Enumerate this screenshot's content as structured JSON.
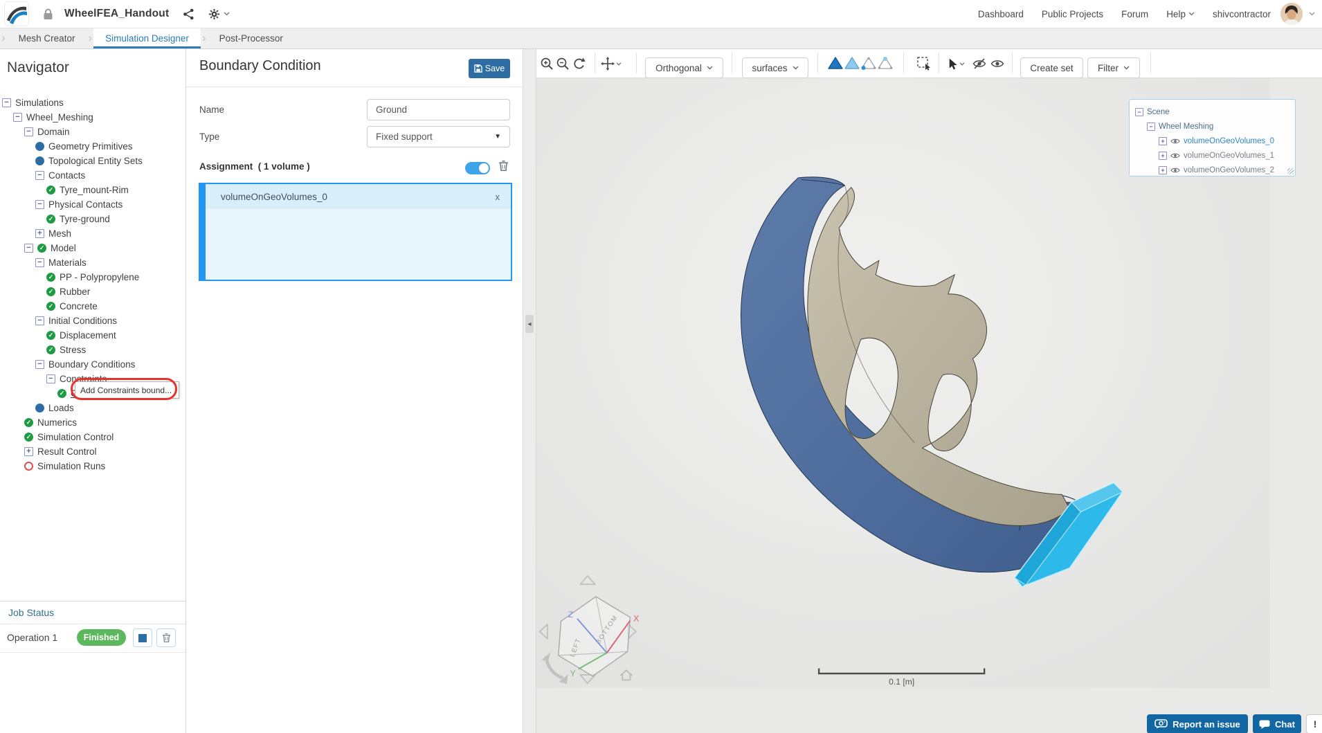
{
  "topbar": {
    "project_title": "WheelFEA_Handout",
    "nav_links": [
      "Dashboard",
      "Public Projects",
      "Forum"
    ],
    "help_label": "Help",
    "username": "shivcontractor"
  },
  "tabs": [
    {
      "label": "Mesh Creator",
      "active": false
    },
    {
      "label": "Simulation Designer",
      "active": true
    },
    {
      "label": "Post-Processor",
      "active": false
    }
  ],
  "navigator": {
    "title": "Navigator",
    "tree": [
      {
        "label": "Simulations",
        "level": 0,
        "expander": "minus"
      },
      {
        "label": "Wheel_Meshing",
        "level": 1,
        "expander": "minus"
      },
      {
        "label": "Domain",
        "level": 2,
        "expander": "minus"
      },
      {
        "label": "Geometry Primitives",
        "level": 3,
        "icon": "blue-dot"
      },
      {
        "label": "Topological Entity Sets",
        "level": 3,
        "icon": "blue-dot"
      },
      {
        "label": "Contacts",
        "level": 3,
        "expander": "minus"
      },
      {
        "label": "Tyre_mount-Rim",
        "level": 4,
        "icon": "check"
      },
      {
        "label": "Physical Contacts",
        "level": 3,
        "expander": "minus"
      },
      {
        "label": "Tyre-ground",
        "level": 4,
        "icon": "check"
      },
      {
        "label": "Mesh",
        "level": 3,
        "expander": "plus"
      },
      {
        "label": "Model",
        "level": 2,
        "expander": "minus",
        "icon": "check"
      },
      {
        "label": "Materials",
        "level": 3,
        "expander": "minus"
      },
      {
        "label": "PP - Polypropylene",
        "level": 4,
        "icon": "check"
      },
      {
        "label": "Rubber",
        "level": 4,
        "icon": "check"
      },
      {
        "label": "Concrete",
        "level": 4,
        "icon": "check"
      },
      {
        "label": "Initial Conditions",
        "level": 3,
        "expander": "minus"
      },
      {
        "label": "Displacement",
        "level": 4,
        "icon": "check"
      },
      {
        "label": "Stress",
        "level": 4,
        "icon": "check"
      },
      {
        "label": "Boundary Conditions",
        "level": 3,
        "expander": "minus"
      },
      {
        "label": "Constraints",
        "level": 4,
        "expander": "minus"
      },
      {
        "label": "Ground",
        "level": 5,
        "icon": "check",
        "underline": true
      },
      {
        "label": "Loads",
        "level": 3,
        "icon": "blue-dot"
      },
      {
        "label": "Numerics",
        "level": 2,
        "icon": "check"
      },
      {
        "label": "Simulation Control",
        "level": 2,
        "icon": "check"
      },
      {
        "label": "Result Control",
        "level": 2,
        "expander": "plus"
      },
      {
        "label": "Simulation Runs",
        "level": 2,
        "icon": "red-circle"
      }
    ],
    "context_tooltip": "Add Constraints bound...",
    "job_status": {
      "header": "Job Status",
      "operation": "Operation 1",
      "badge": "Finished"
    }
  },
  "properties": {
    "title": "Boundary Condition",
    "save_label": "Save",
    "name_label": "Name",
    "name_value": "Ground",
    "type_label": "Type",
    "type_value": "Fixed support",
    "assignment_label": "Assignment",
    "assignment_count": "( 1 volume )",
    "assignment_item": "volumeOnGeoVolumes_0",
    "remove_label": "x"
  },
  "viewport": {
    "toolbar": {
      "projection": "Orthogonal",
      "render_mode": "surfaces",
      "create_set_label": "Create set",
      "filter_label": "Filter"
    },
    "scene_tree": {
      "root": "Scene",
      "group": "Wheel Meshing",
      "volumes": [
        {
          "label": "volumeOnGeoVolumes_0",
          "active": true
        },
        {
          "label": "volumeOnGeoVolumes_1",
          "active": false
        },
        {
          "label": "volumeOnGeoVolumes_2",
          "active": false
        }
      ]
    },
    "scale_label": "0.1 [m]",
    "cube": {
      "bottom": "BOTTOM",
      "left": "LEFT",
      "x": "X",
      "y": "Y",
      "z": "Z"
    },
    "report_button": "Report an issue",
    "chat_button": "Chat",
    "alert_button": "!"
  },
  "colors": {
    "accent": "#2e6da4",
    "selection_blue": "#2196f3",
    "highlight_cyan": "#2db9e9",
    "finished_green": "#5cb85c",
    "active_tab_blue": "#2b7cb9",
    "tyre_blue": "#4d6c9d",
    "rim_tan": "#b8b19c"
  }
}
